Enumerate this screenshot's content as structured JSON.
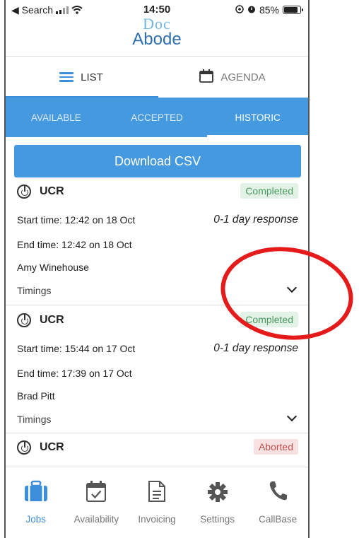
{
  "status_bar": {
    "back_label": "◀ Search",
    "time": "14:50",
    "battery": "85%",
    "battery_level": 0.85
  },
  "logo": {
    "top": "Doc",
    "bottom": "Abode"
  },
  "view_toggle": {
    "list_label": "LIST",
    "agenda_label": "AGENDA"
  },
  "tabs": [
    {
      "label": "AVAILABLE"
    },
    {
      "label": "ACCEPTED"
    },
    {
      "label": "HISTORIC",
      "active": true
    }
  ],
  "download_label": "Download CSV",
  "jobs": [
    {
      "type": "UCR",
      "status": "Completed",
      "start": "Start time: 12:42 on 18 Oct",
      "response": "0-1 day response",
      "end": "End time: 12:42 on 18 Oct",
      "name": "Amy Winehouse",
      "timings": "Timings"
    },
    {
      "type": "UCR",
      "status": "Completed",
      "start": "Start time: 15:44 on 17 Oct",
      "response": "0-1 day response",
      "end": "End time: 17:39 on 17 Oct",
      "name": "Brad Pitt",
      "timings": "Timings"
    },
    {
      "type": "UCR",
      "status": "Aborted"
    }
  ],
  "bottom_nav": [
    {
      "label": "Jobs",
      "icon": "briefcase-icon",
      "active": true
    },
    {
      "label": "Availability",
      "icon": "calendar-check-icon"
    },
    {
      "label": "Invoicing",
      "icon": "document-icon"
    },
    {
      "label": "Settings",
      "icon": "gear-icon"
    },
    {
      "label": "CallBase",
      "icon": "phone-icon"
    }
  ],
  "colors": {
    "accent": "#4499df",
    "completed_bg": "#e3f2e6",
    "completed_text": "#4a9a5f",
    "aborted_bg": "#f8e1e1",
    "aborted_text": "#c0504d",
    "annotation": "#e51a1a"
  }
}
